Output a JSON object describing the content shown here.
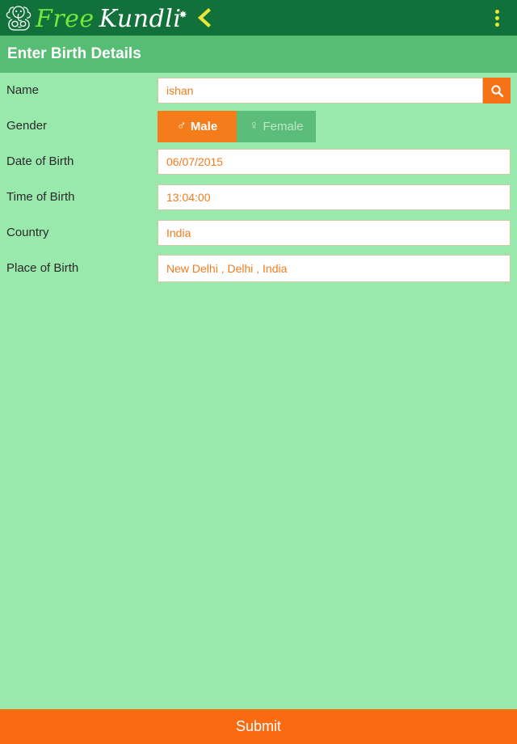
{
  "appbar": {
    "logo_icon": "ganesha-icon",
    "brand_word1": "Free",
    "brand_word2": "Kundli",
    "brand_star": "✸",
    "back_icon": "back-chevron-icon",
    "menu_icon": "overflow-menu-icon",
    "bg_color": "#12713a",
    "brand_color_1": "#74e83c",
    "brand_color_2": "#ffffff",
    "accent_yellow": "#e8e83a"
  },
  "subheader": {
    "title": "Enter Birth Details",
    "bg_color": "#57bd75"
  },
  "form": {
    "fields": [
      {
        "label": "Name",
        "value": "ishan",
        "placeholder": "Name",
        "has_search": true,
        "search_icon": "search-icon"
      },
      {
        "label": "Date of Birth",
        "value": "06/07/2015",
        "placeholder": "Date of Birth"
      },
      {
        "label": "Time of Birth",
        "value": "13:04:00",
        "placeholder": "Time of Birth"
      },
      {
        "label": "Country",
        "value": "India",
        "placeholder": "Country"
      },
      {
        "label": "Place of Birth",
        "value": "New Delhi , Delhi , India",
        "placeholder": "Place of Birth"
      }
    ],
    "gender": {
      "label": "Gender",
      "selected": "Male",
      "options": [
        {
          "label": "Male",
          "symbol": "♂",
          "selected": true
        },
        {
          "label": "Female",
          "symbol": "♀",
          "selected": false
        }
      ]
    },
    "value_color": "#f07c1f",
    "label_color": "#2b2b2b"
  },
  "submit": {
    "label": "Submit",
    "bg_color": "#f96a11"
  },
  "page": {
    "bg_color": "#99e8ac"
  }
}
